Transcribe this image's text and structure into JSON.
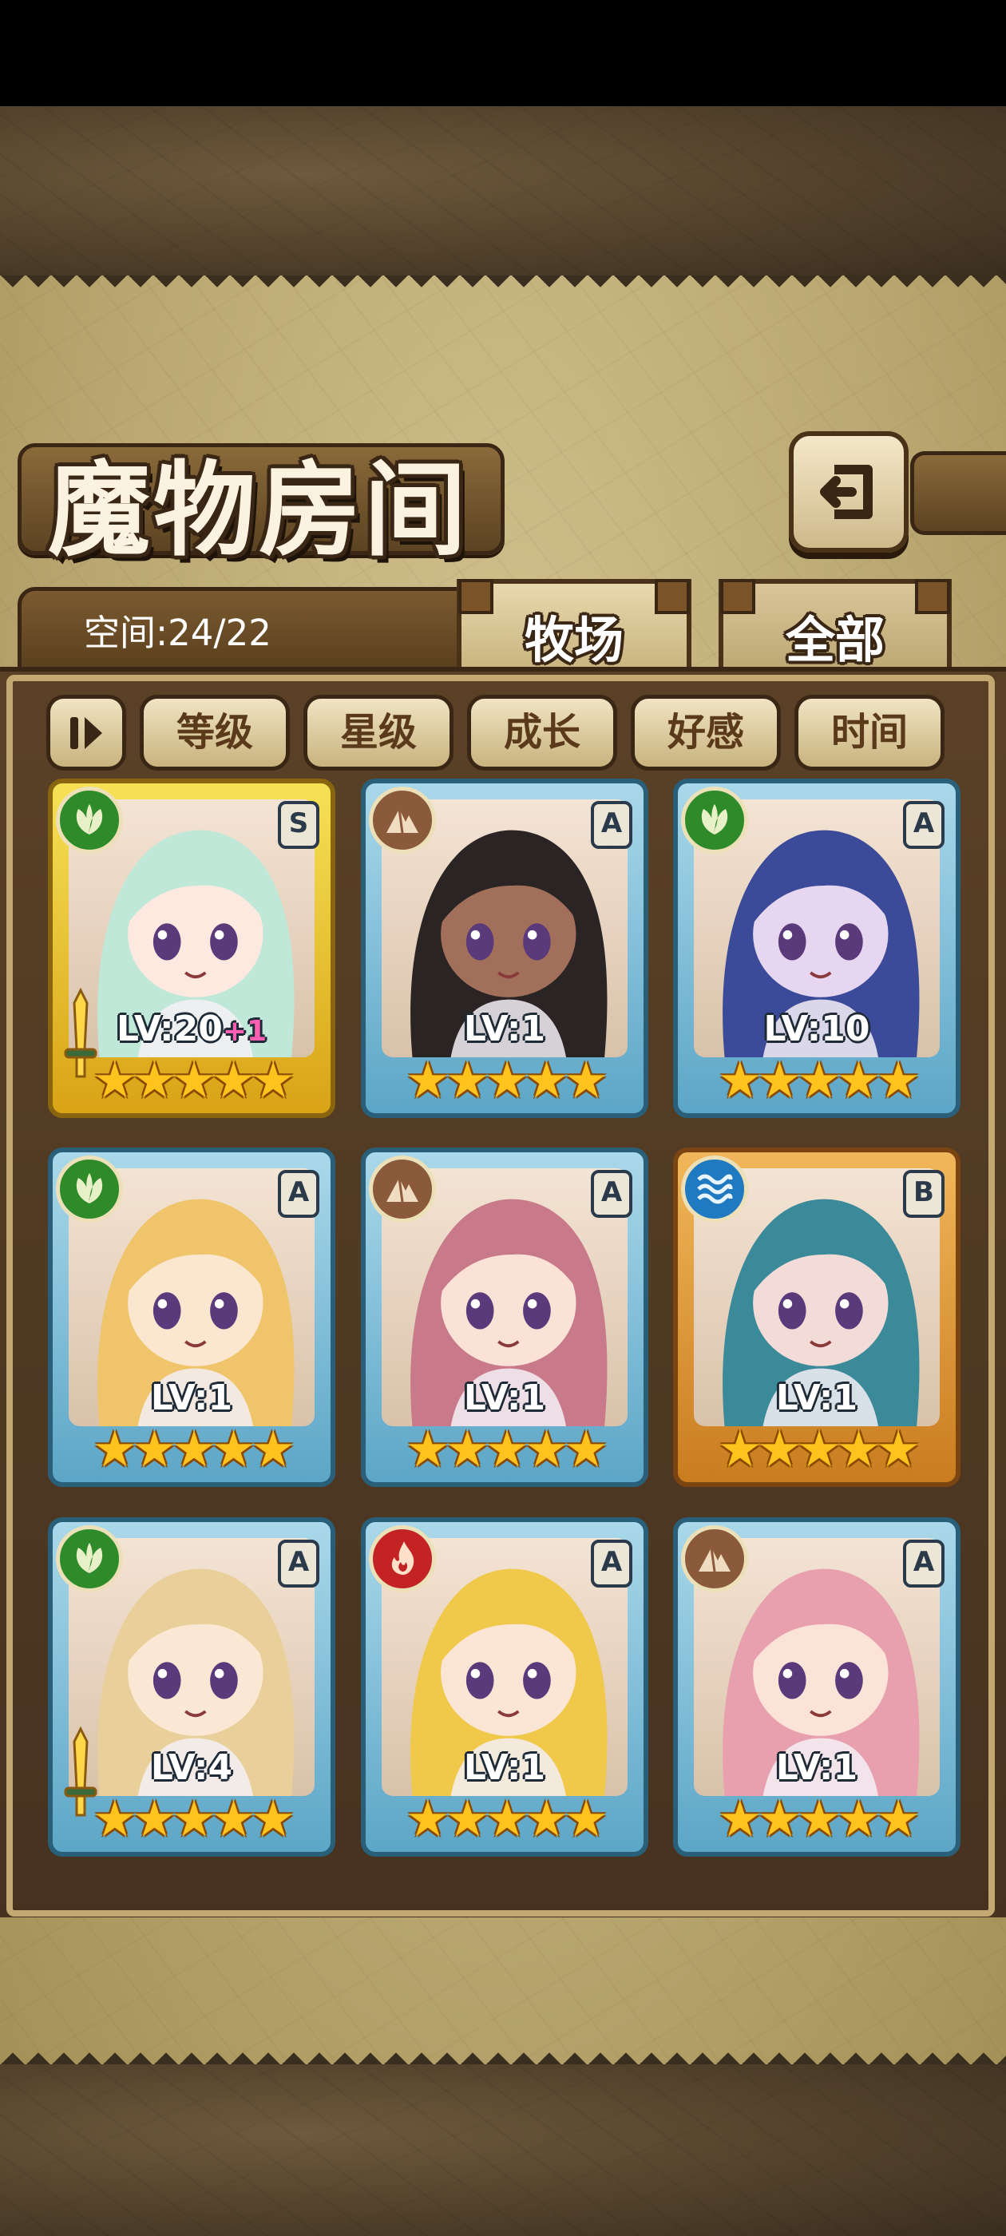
{
  "header": {
    "title": "魔物房间",
    "back_icon": "back-arrow-icon"
  },
  "info": {
    "space_label": "空间:24/22"
  },
  "tabs": [
    {
      "label": "牧场",
      "active": true
    },
    {
      "label": "全部",
      "active": false
    }
  ],
  "sort": {
    "toggle_icon": "sort-toggle-icon",
    "buttons": [
      "等级",
      "星级",
      "成长",
      "好感",
      "时间"
    ]
  },
  "monsters": [
    {
      "element": "nature",
      "element_color": "#2f8a2a",
      "rank": "S",
      "level": "LV:20",
      "bonus": "+1",
      "stars": "★★★★★",
      "has_weapon": true,
      "hair": "#bfe8d8",
      "skin": "#fde9e0"
    },
    {
      "element": "earth",
      "element_color": "#8a5a3a",
      "rank": "A",
      "level": "LV:1",
      "bonus": "",
      "stars": "★★★★★",
      "has_weapon": false,
      "hair": "#2a2424",
      "skin": "#a2705a"
    },
    {
      "element": "nature",
      "element_color": "#2f8a2a",
      "rank": "A",
      "level": "LV:10",
      "bonus": "",
      "stars": "★★★★★",
      "has_weapon": false,
      "hair": "#3c4a9a",
      "skin": "#e7d6f0"
    },
    {
      "element": "nature",
      "element_color": "#2f8a2a",
      "rank": "A",
      "level": "LV:1",
      "bonus": "",
      "stars": "★★★★★",
      "has_weapon": false,
      "hair": "#f0c46a",
      "skin": "#fbe6cf"
    },
    {
      "element": "earth",
      "element_color": "#8a5a3a",
      "rank": "A",
      "level": "LV:1",
      "bonus": "",
      "stars": "★★★★★",
      "has_weapon": false,
      "hair": "#c97a8a",
      "skin": "#fbe2d6"
    },
    {
      "element": "water",
      "element_color": "#1f7ac2",
      "rank": "B",
      "level": "LV:1",
      "bonus": "",
      "stars": "★★★★★",
      "has_weapon": false,
      "hair": "#3a8a9a",
      "skin": "#f3dcd8"
    },
    {
      "element": "nature",
      "element_color": "#2f8a2a",
      "rank": "A",
      "level": "LV:4",
      "bonus": "",
      "stars": "★★★★★",
      "has_weapon": true,
      "hair": "#e9cf9a",
      "skin": "#fbe8d4"
    },
    {
      "element": "fire",
      "element_color": "#c42323",
      "rank": "A",
      "level": "LV:1",
      "bonus": "",
      "stars": "★★★★★",
      "has_weapon": false,
      "hair": "#f0c84a",
      "skin": "#fbe6d6"
    },
    {
      "element": "earth",
      "element_color": "#8a5a3a",
      "rank": "A",
      "level": "LV:1",
      "bonus": "",
      "stars": "★★★★★",
      "has_weapon": false,
      "hair": "#e8a0ae",
      "skin": "#fbe3d8"
    }
  ]
}
